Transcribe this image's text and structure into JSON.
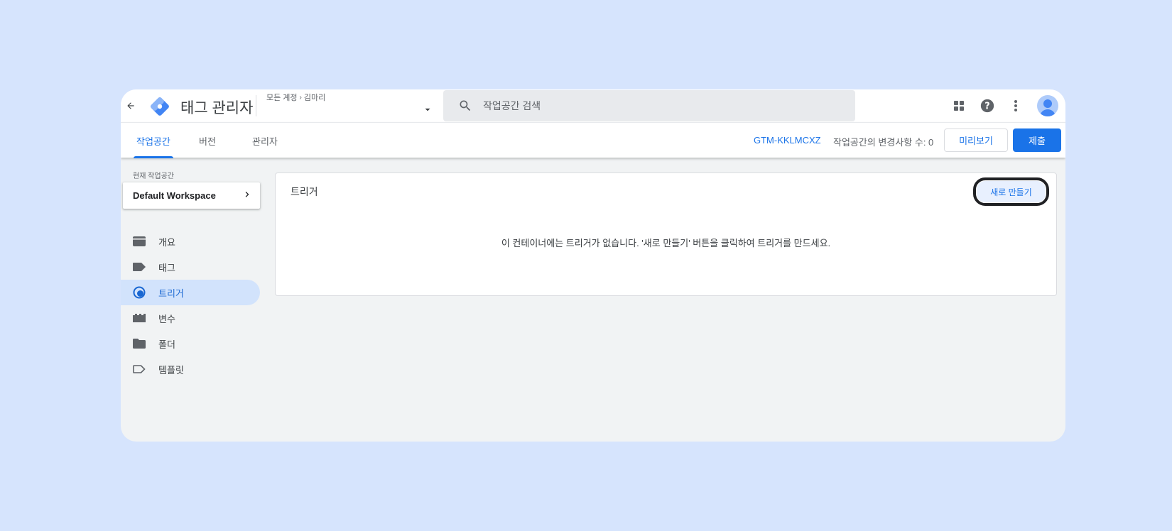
{
  "header": {
    "app_title": "태그 관리자",
    "breadcrumb": {
      "accounts": "모든 계정",
      "separator": "›",
      "account": "김마리"
    },
    "search_placeholder": "작업공간 검색",
    "icons": [
      "apps-icon",
      "help-icon",
      "more-vert-icon",
      "avatar"
    ]
  },
  "tabs": [
    {
      "label": "작업공간",
      "active": true
    },
    {
      "label": "버전",
      "active": false
    },
    {
      "label": "관리자",
      "active": false
    }
  ],
  "toolbar": {
    "container_id": "GTM-KKLMCXZ",
    "changes_text": "작업공간의 변경사항 수: 0",
    "preview_label": "미리보기",
    "submit_label": "제출"
  },
  "sidebar": {
    "workspace_caption": "현재 작업공간",
    "workspace_name": "Default Workspace",
    "items": [
      {
        "label": "개요",
        "icon": "overview-icon",
        "active": false
      },
      {
        "label": "태그",
        "icon": "tag-icon",
        "active": false
      },
      {
        "label": "트리거",
        "icon": "trigger-icon",
        "active": true
      },
      {
        "label": "변수",
        "icon": "variable-icon",
        "active": false
      },
      {
        "label": "폴더",
        "icon": "folder-icon",
        "active": false
      },
      {
        "label": "템플릿",
        "icon": "template-icon",
        "active": false
      }
    ]
  },
  "main": {
    "title": "트리거",
    "new_button_label": "새로 만들기",
    "empty_message": "이 컨테이너에는 트리거가 없습니다. '새로 만들기' 버튼을 클릭하여 트리거를 만드세요."
  },
  "colors": {
    "page_background": "#d6e4fd",
    "accent": "#1a73e8",
    "active_nav_bg": "#d2e3fc"
  }
}
